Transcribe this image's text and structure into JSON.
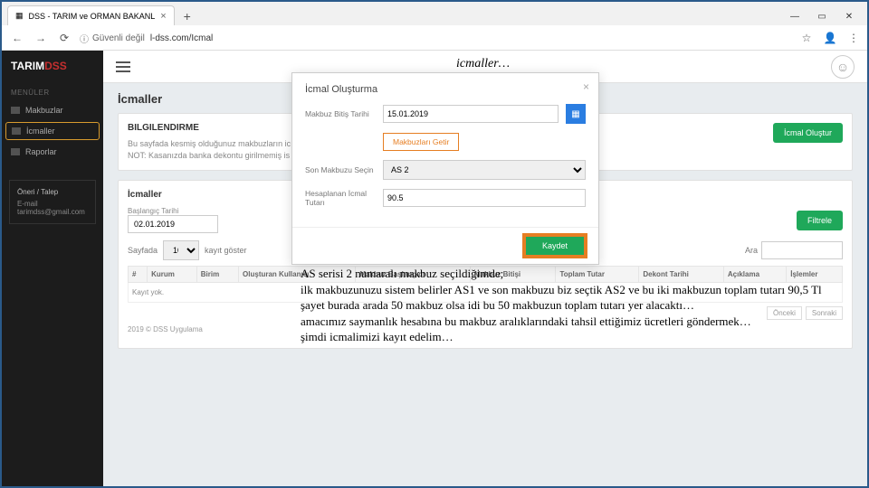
{
  "browser": {
    "tab_title": "DSS - TARIM ve ORMAN BAKANL",
    "url_security": "Güvenli değil",
    "url": "l-dss.com/Icmal"
  },
  "sidebar": {
    "brand1": "TARIM",
    "brand2": "DSS",
    "menu_header": "MENÜLER",
    "items": [
      "Makbuzlar",
      "İcmaller",
      "Raporlar"
    ],
    "support_title": "Öneri / Talep",
    "support_label": "E-mail",
    "support_email": "tarimdss@gmail.com"
  },
  "page": {
    "title": "İcmaller",
    "info_header": "BILGILENDIRME",
    "info_line1": "Bu sayfada kesmiş olduğunuz makbuzların ic",
    "info_line2": "NOT: Kasanızda banka dekontu girilmemiş is",
    "create_btn": "İcmal Oluştur",
    "list_header": "İcmaller",
    "start_label": "Başlangıç Tarihi",
    "start_value": "02.01.2019",
    "filter_btn": "Filtrele",
    "per_page_label": "Sayfada",
    "per_page_value": "10",
    "per_page_suffix": "kayıt göster",
    "search_label": "Ara",
    "columns": [
      "#",
      "Kurum",
      "Birim",
      "Oluşturan Kullanıcı",
      "Makbuz Başlangıcı",
      "Makbuz Bitişi",
      "Toplam Tutar",
      "Dekont Tarihi",
      "Açıklama",
      "İşlemler"
    ],
    "empty": "Kayıt yok.",
    "pager_prev": "Önceki",
    "pager_next": "Sonraki",
    "footer": "2019 © DSS Uygulama"
  },
  "modal": {
    "title": "İcmal Oluşturma",
    "row1_label": "Makbuz Bitiş Tarihi",
    "row1_value": "15.01.2019",
    "orange_btn": "Makbuzları Getir",
    "row2_label": "Son Makbuzu Seçin",
    "row2_value": "AS 2",
    "row3_label": "Hesaplanan İcmal Tutarı",
    "row3_value": "90.5",
    "save": "Kaydet"
  },
  "annotation": {
    "title": "icmaller…",
    "body": "AS serisi 2 numaralı makbuz seçildiğimde;\nilk makbuzunuzu sistem belirler AS1 ve son makbuzu biz seçtik AS2 ve bu iki makbuzun toplam tutarı 90,5 Tl\nşayet burada arada 50 makbuz olsa idi bu 50 makbuzun toplam tutarı yer alacaktı…\namacımız saymanlık hesabına bu makbuz aralıklarındaki tahsil ettiğimiz ücretleri göndermek…\nşimdi icmalimizi kayıt edelim…"
  }
}
